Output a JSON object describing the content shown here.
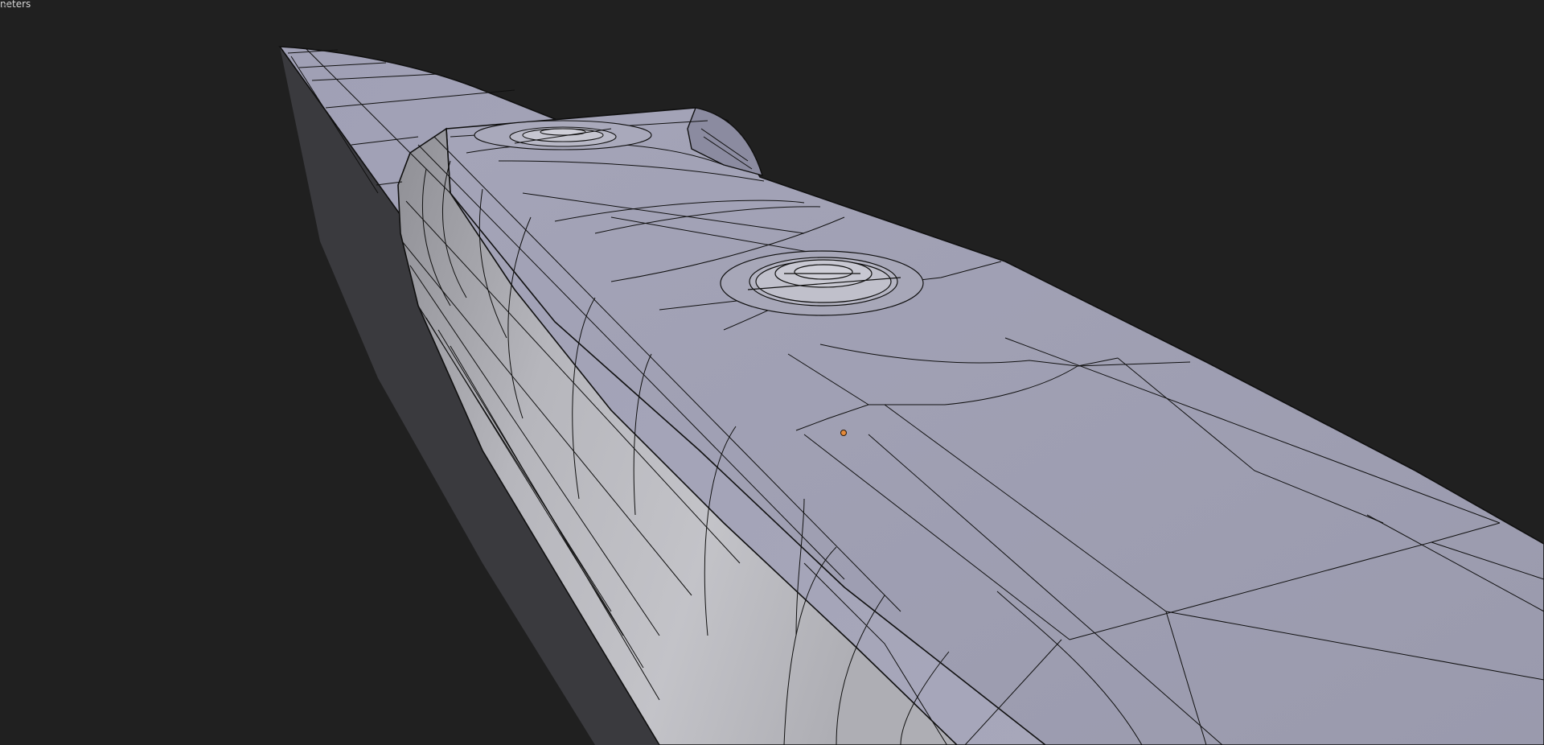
{
  "viewport": {
    "units_label": "neters",
    "background": "#202020",
    "mesh_top_face_color": "#9d9db1",
    "mesh_side_face_color": "#b3b3ba",
    "wire_color": "#101010",
    "origin_point_color": "#e58a3a",
    "icons": {
      "corner": "viewport-corner-resize-icon",
      "origin": "object-origin-icon"
    }
  }
}
